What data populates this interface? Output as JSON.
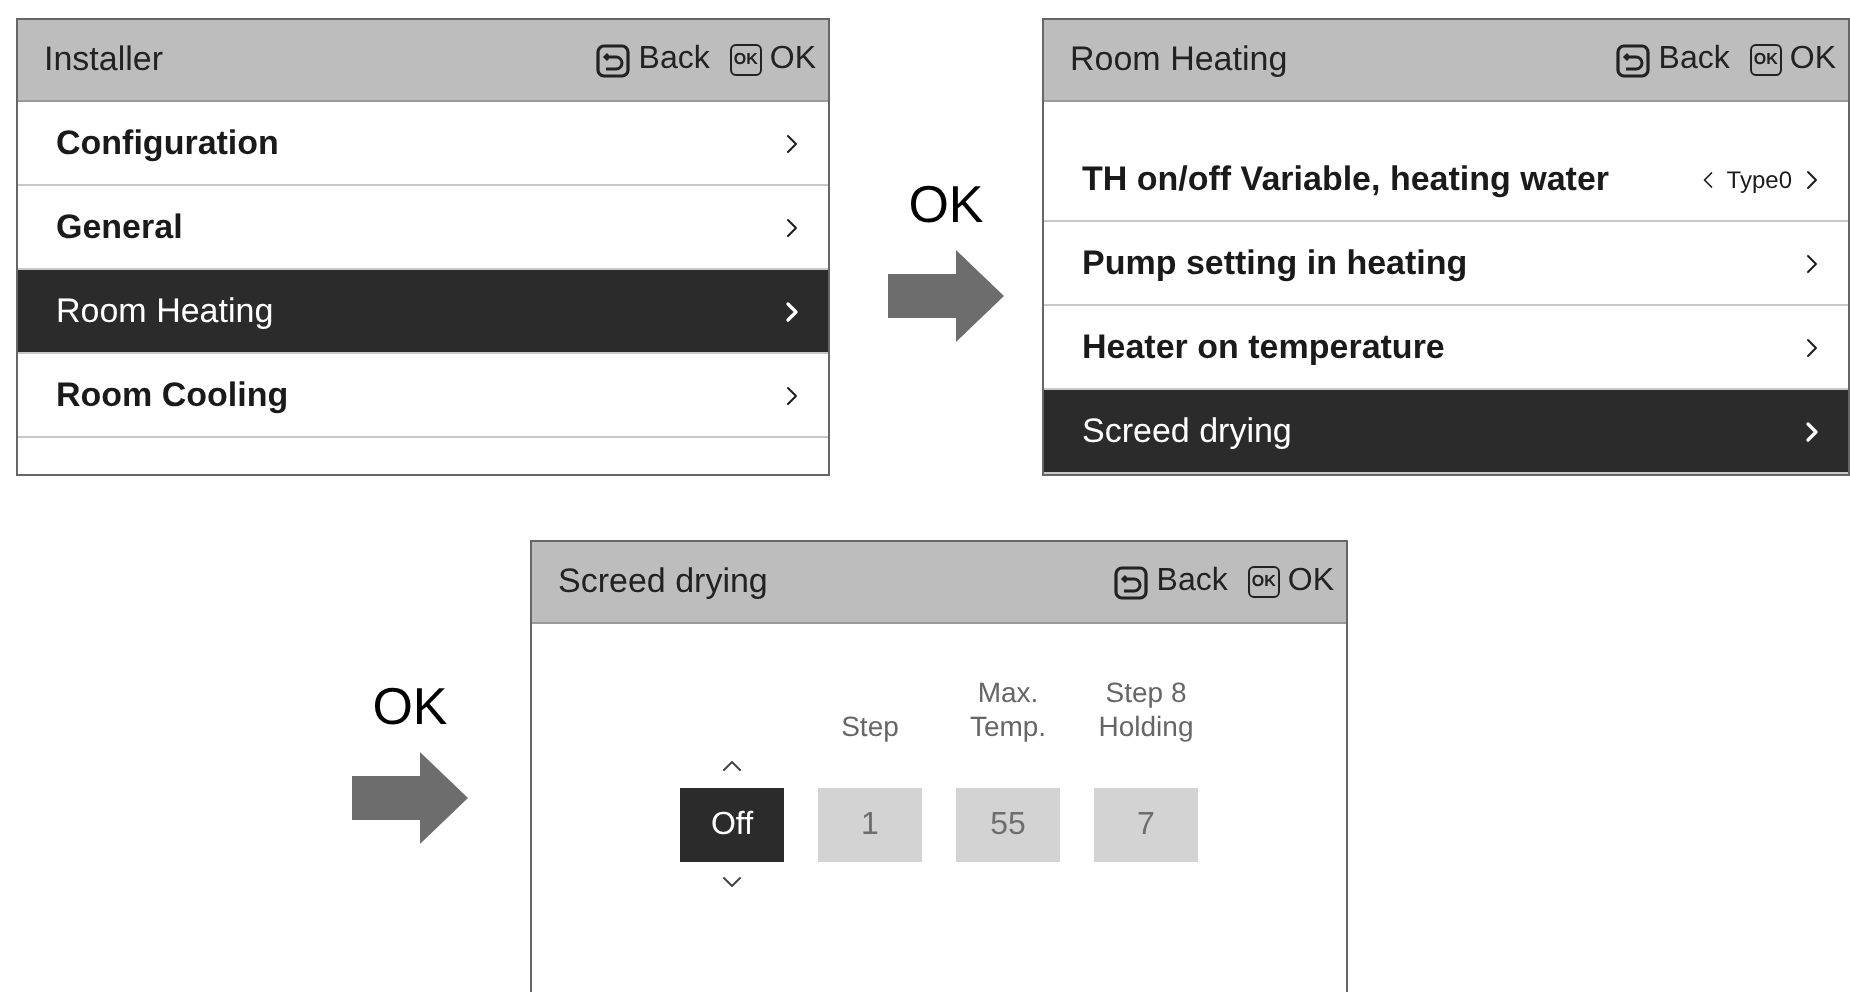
{
  "screens": [
    {
      "kind": "menu",
      "title": "Installer",
      "buttons": [
        {
          "kind": "back",
          "label": "Back"
        },
        {
          "kind": "ok",
          "key": "OK",
          "label": "OK"
        }
      ],
      "rows": [
        {
          "label": "Configuration",
          "selected": false
        },
        {
          "label": "General",
          "selected": false
        },
        {
          "label": "Room Heating",
          "selected": true
        },
        {
          "label": "Room Cooling",
          "selected": false
        }
      ]
    },
    {
      "kind": "menu",
      "title": "Room Heating",
      "buttons": [
        {
          "kind": "back",
          "label": "Back"
        },
        {
          "kind": "ok",
          "key": "OK",
          "label": "OK"
        }
      ],
      "rows": [
        {
          "label": "TH on/off Variable, heating water",
          "value": "Type0",
          "selected": false
        },
        {
          "label": "Pump setting in heating",
          "selected": false
        },
        {
          "label": "Heater on temperature",
          "selected": false
        },
        {
          "label": "Screed drying",
          "selected": true
        }
      ]
    },
    {
      "kind": "editor",
      "title": "Screed drying",
      "buttons": [
        {
          "kind": "back",
          "label": "Back"
        },
        {
          "kind": "ok",
          "key": "OK",
          "label": "OK"
        }
      ],
      "fields": [
        {
          "value": "Off",
          "selected": true
        },
        {
          "label": "Step",
          "value": "1",
          "selected": false
        },
        {
          "label": "Max.\nTemp.",
          "value": "55",
          "selected": false
        },
        {
          "label": "Step 8\nHolding",
          "value": "7",
          "selected": false
        }
      ]
    }
  ],
  "transitions": [
    {
      "label": "OK"
    },
    {
      "label": "OK"
    }
  ]
}
